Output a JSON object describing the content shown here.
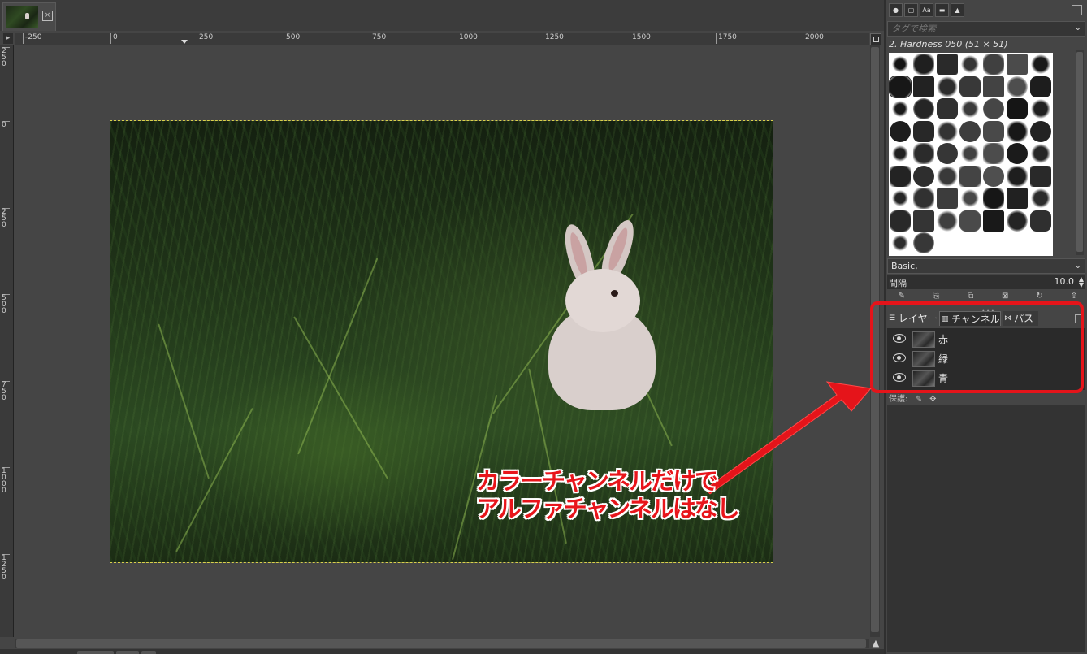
{
  "image_tab": {
    "close_icon": "close-x"
  },
  "rulers": {
    "corner_icon": "ruler-menu-arrow",
    "horizontal_ticks": [
      "-250",
      "0",
      "250",
      "500",
      "750",
      "1000",
      "1250",
      "1500",
      "1750",
      "2000"
    ],
    "vertical_ticks": [
      "250",
      "0",
      "250",
      "500",
      "750",
      "1000",
      "1250"
    ]
  },
  "brushes": {
    "tag_filter_placeholder": "タグで検索",
    "selected_brush": "2. Hardness 050 (51 × 51)",
    "preset": "Basic,",
    "spacing_label": "間隔",
    "spacing_value": "10.0"
  },
  "channels_dock": {
    "tabs": [
      {
        "label": "レイヤー",
        "icon": "layers-icon"
      },
      {
        "label": "チャンネル",
        "icon": "channels-icon"
      },
      {
        "label": "パス",
        "icon": "paths-icon"
      }
    ],
    "channels": [
      {
        "name": "赤",
        "visible": true
      },
      {
        "name": "緑",
        "visible": true
      },
      {
        "name": "青",
        "visible": true
      }
    ],
    "lock_label": "保護:"
  },
  "annotation": {
    "line1": "カラーチャンネルだけで",
    "line2": "アルファチャンネルはなし",
    "color": "#e5141a"
  }
}
